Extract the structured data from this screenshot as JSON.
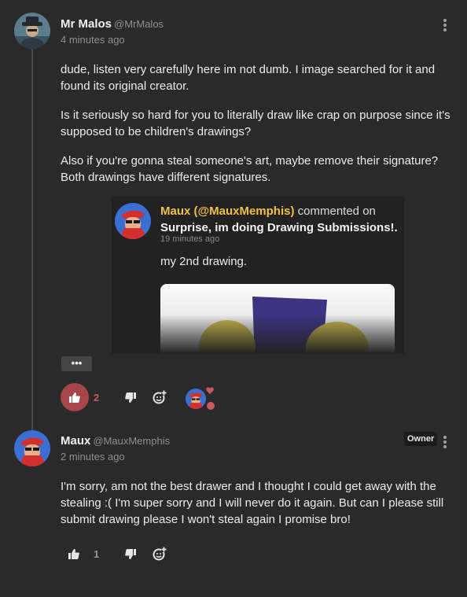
{
  "comments": [
    {
      "author": "Mr Malos",
      "handle": "@MrMalos",
      "time": "4 minutes ago",
      "paragraphs": [
        "dude, listen very carefully here im not dumb. I image searched for it and found its original creator.",
        "Is it seriously so hard for you to literally draw like crap on purpose since it's supposed to be children's drawings?",
        "Also if you're gonna steal someone's art, maybe remove their signature? Both drawings have different signatures."
      ],
      "embed": {
        "author": "Maux (@MauxMemphis)",
        "action": "commented on",
        "post_title": "Surprise, im doing Drawing Submissions!.",
        "time": "19 minutes ago",
        "text": "my 2nd drawing."
      },
      "more_label": "•••",
      "likes": "2",
      "liked": true
    },
    {
      "author": "Maux",
      "handle": "@MauxMemphis",
      "badge": "Owner",
      "time": "2 minutes ago",
      "paragraphs": [
        "I'm sorry, am not the best drawer and I thought I could get away with the stealing :( I'm super sorry and I will never do it again. But can I please still submit drawing please I won't steal again I promise bro!"
      ],
      "likes": "1",
      "liked": false
    }
  ],
  "colors": {
    "background": "#2a2a2a",
    "liked_accent": "#a6454a",
    "embed_author": "#f0c043"
  },
  "icons": [
    "thumbs-up-icon",
    "thumbs-down-icon",
    "add-reaction-icon",
    "kebab-menu-icon",
    "heart-icon"
  ]
}
